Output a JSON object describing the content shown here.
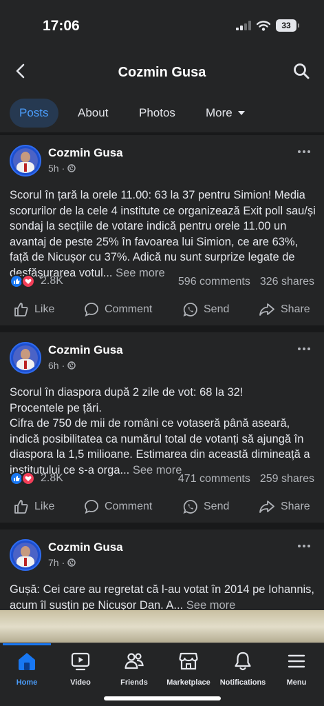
{
  "status": {
    "time": "17:06",
    "battery": "33"
  },
  "header": {
    "title": "Cozmin Gusa"
  },
  "tabs": [
    {
      "label": "Posts"
    },
    {
      "label": "About"
    },
    {
      "label": "Photos"
    },
    {
      "label": "More"
    }
  ],
  "posts": [
    {
      "author": "Cozmin Gusa",
      "time": "5h",
      "text": "Scorul în țară la orele 11.00: 63 la 37 pentru Simion! Media scorurilor de la cele 4 institute ce organizează Exit poll sau/și sondaj la secțiile de votare indică pentru orele 11.00 un avantaj de peste 25% în favoarea lui Simion, ce are 63%, față de Nicușor cu 37%. Adică nu sunt surprize legate de desfășurarea votul...",
      "see_more": "See more",
      "reactions": "2.8K",
      "comments": "596 comments",
      "shares": "326 shares"
    },
    {
      "author": "Cozmin Gusa",
      "time": "6h",
      "text_lines": [
        "Scorul în diaspora după 2 zile de vot: 68 la 32!",
        "Procentele pe țări.",
        "Cifra de 750 de mii de români ce votaseră până aseară, indică posibilitatea ca numărul total de votanți să ajungă în diaspora la 1,5 milioane. Estimarea din această dimineață a institutului ce s-a orga..."
      ],
      "see_more": "See more",
      "reactions": "2.8K",
      "comments": "471 comments",
      "shares": "259 shares"
    },
    {
      "author": "Cozmin Gusa",
      "time": "7h",
      "text": "Gușă: Cei care au regretat că l-au votat în 2014 pe Iohannis, acum îl susțin pe Nicușor Dan. A...",
      "see_more": "See more"
    }
  ],
  "actions": {
    "like": "Like",
    "comment": "Comment",
    "send": "Send",
    "share": "Share"
  },
  "nav": [
    {
      "label": "Home",
      "icon": "home-icon"
    },
    {
      "label": "Video",
      "icon": "video-icon"
    },
    {
      "label": "Friends",
      "icon": "friends-icon"
    },
    {
      "label": "Marketplace",
      "icon": "marketplace-icon"
    },
    {
      "label": "Notifications",
      "icon": "bell-icon"
    },
    {
      "label": "Menu",
      "icon": "menu-icon"
    }
  ],
  "colors": {
    "accent": "#1877f2",
    "background": "#18191a",
    "surface": "#242526",
    "love": "#f33e58"
  }
}
